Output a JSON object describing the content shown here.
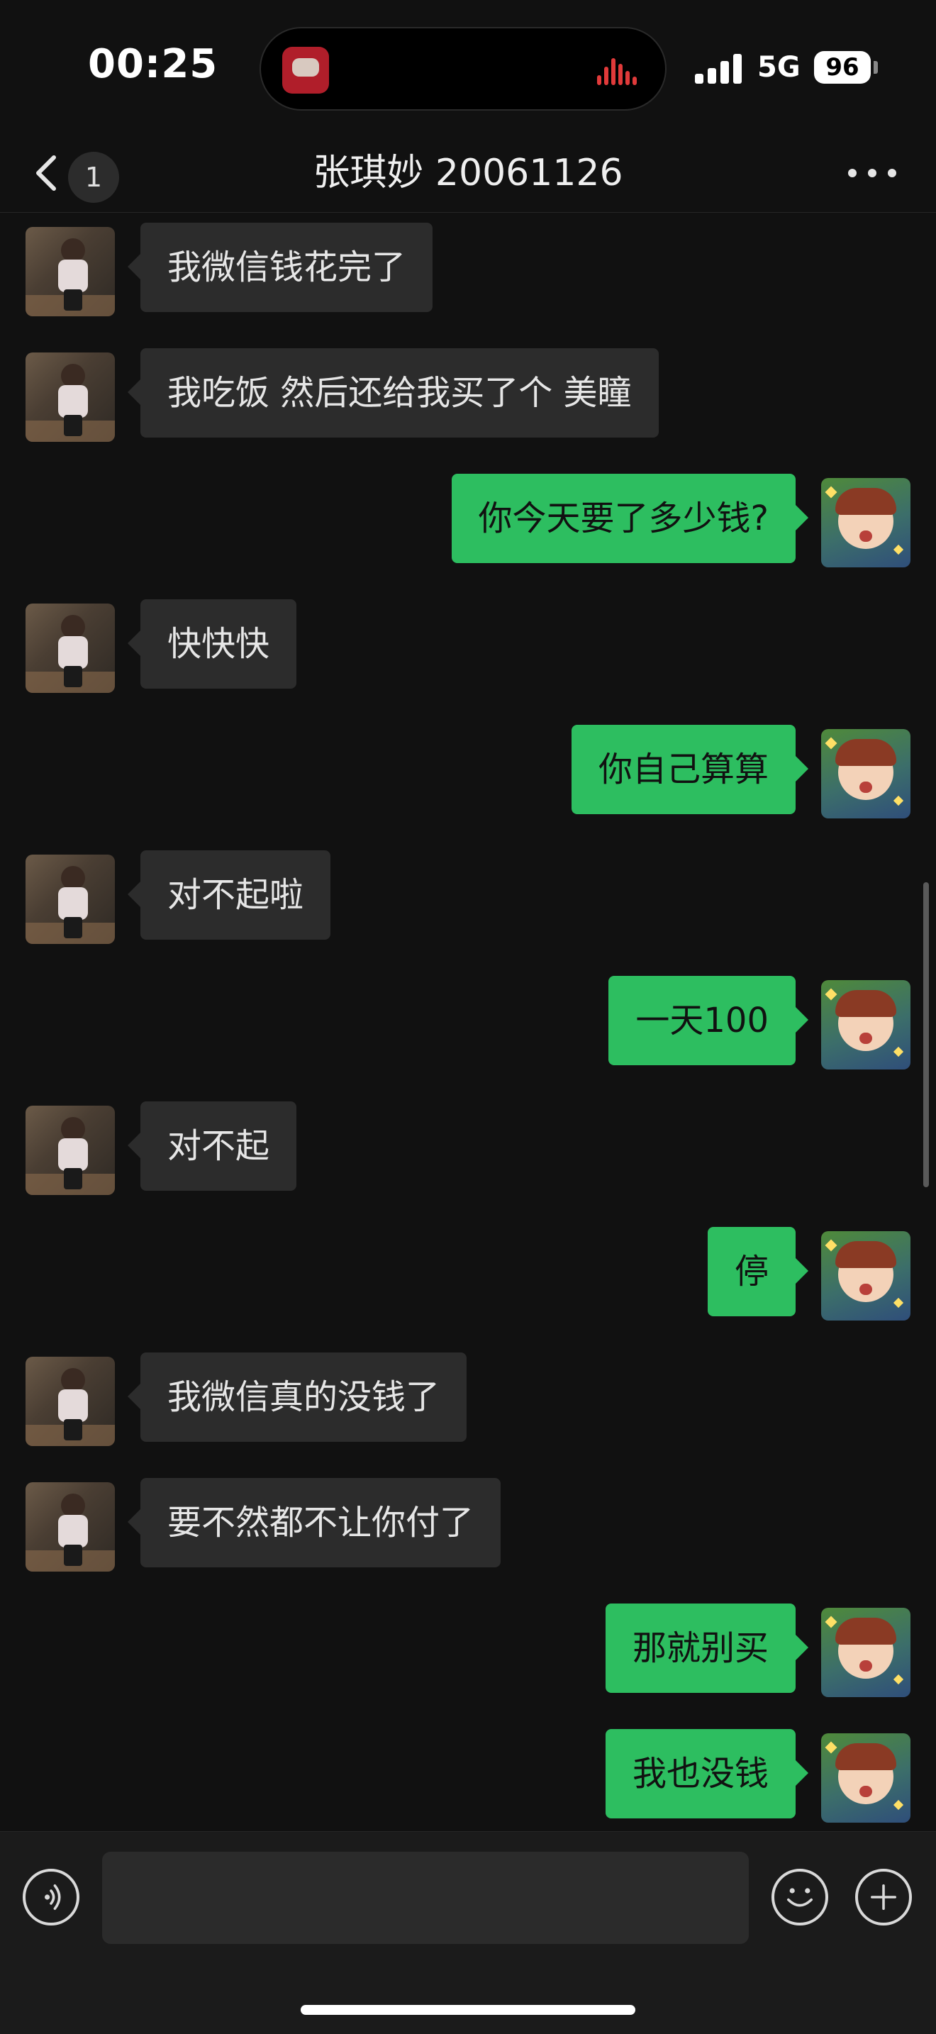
{
  "status_bar": {
    "time": "00:25",
    "network": "5G",
    "battery": "96",
    "icons": [
      "music-app-icon",
      "audio-wave-icon",
      "signal-icon",
      "battery-icon"
    ]
  },
  "header": {
    "unread_count": "1",
    "title": "张琪妙 20061126",
    "icons": [
      "back-chevron-icon",
      "more-dots-icon"
    ]
  },
  "messages": [
    {
      "side": "in",
      "text": "我微信钱花完了"
    },
    {
      "side": "in",
      "text": "我吃饭 然后还给我买了个 美瞳"
    },
    {
      "side": "out",
      "text": "你今天要了多少钱?"
    },
    {
      "side": "in",
      "text": "快快快"
    },
    {
      "side": "out",
      "text": "你自己算算"
    },
    {
      "side": "in",
      "text": "对不起啦"
    },
    {
      "side": "out",
      "text": "一天100"
    },
    {
      "side": "in",
      "text": "对不起"
    },
    {
      "side": "out",
      "text": "停"
    },
    {
      "side": "in",
      "text": "我微信真的没钱了"
    },
    {
      "side": "in",
      "text": "要不然都不让你付了"
    },
    {
      "side": "out",
      "text": "那就别买"
    },
    {
      "side": "out",
      "text": "我也没钱"
    }
  ],
  "input_bar": {
    "value": "",
    "icons": [
      "voice-icon",
      "emoji-icon",
      "plus-icon"
    ]
  },
  "colors": {
    "background": "#111111",
    "incoming_bubble": "#2c2c2c",
    "outgoing_bubble": "#2dbe60",
    "input_bar": "#1b1b1b"
  }
}
